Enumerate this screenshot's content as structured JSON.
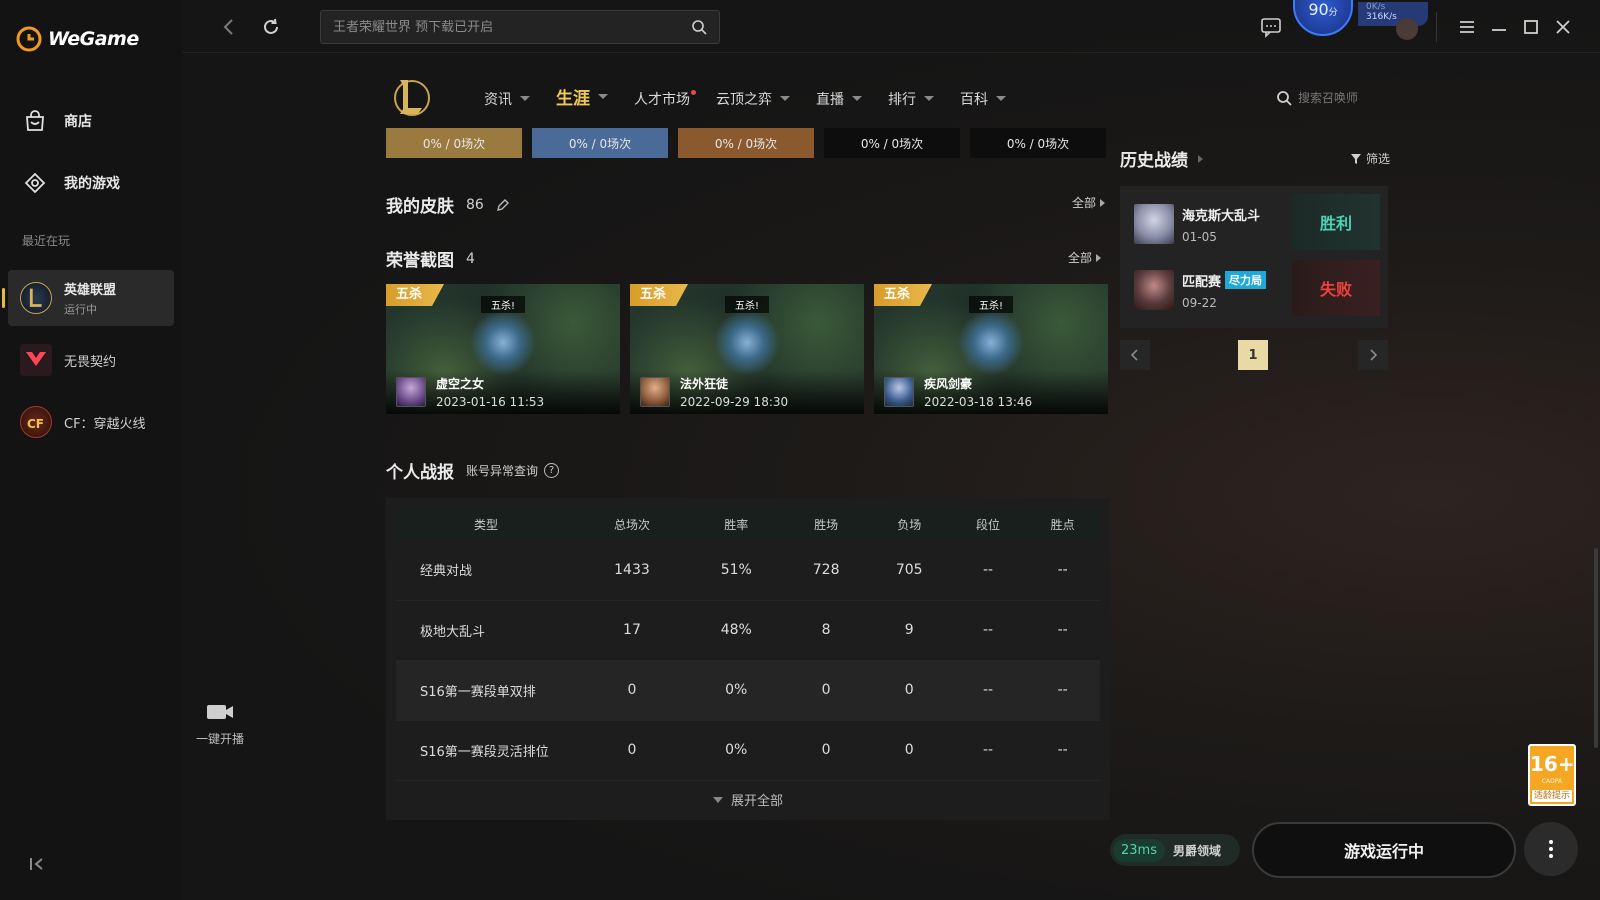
{
  "app": {
    "name": "WeGame"
  },
  "sidebar": {
    "nav": [
      {
        "label": "商店",
        "icon": "store-bag-icon"
      },
      {
        "label": "我的游戏",
        "icon": "game-controller-icon"
      }
    ],
    "recent_label": "最近在玩",
    "games": [
      {
        "title": "英雄联盟",
        "status": "运行中",
        "icon": "lol-icon",
        "active": true
      },
      {
        "title": "无畏契约",
        "status": "",
        "icon": "valorant-icon",
        "active": false
      },
      {
        "title": "CF：穿越火线",
        "status": "",
        "icon": "crossfire-icon",
        "active": false
      }
    ]
  },
  "topbar": {
    "search_placeholder": "王者荣耀世界 预下载已开启",
    "score_value": "90",
    "score_unit": "分",
    "net_speed_up": "0K/s",
    "net_speed_down": "316K/s"
  },
  "game_nav": {
    "items": [
      {
        "label": "资讯",
        "caret": true
      },
      {
        "label": "生涯",
        "caret": true,
        "active": true
      },
      {
        "label": "人才市场",
        "caret": false,
        "dot": true
      },
      {
        "label": "云顶之弈",
        "caret": true
      },
      {
        "label": "直播",
        "caret": true
      },
      {
        "label": "排行",
        "caret": true
      },
      {
        "label": "百科",
        "caret": true
      }
    ],
    "summoner_search_placeholder": "搜索召唤师"
  },
  "rank_bars": [
    {
      "text": "0% / 0场次",
      "color": "#9a7a3e"
    },
    {
      "text": "0% / 0场次",
      "color": "#4a6a98"
    },
    {
      "text": "0% / 0场次",
      "color": "#8a5a2e"
    },
    {
      "text": "0% / 0场次",
      "color": "#0d0d0d"
    },
    {
      "text": "0% / 0场次",
      "color": "#0d0d0d"
    }
  ],
  "skins": {
    "title": "我的皮肤",
    "count": "86",
    "see_all": "全部"
  },
  "screenshots": {
    "title": "荣誉截图",
    "count": "4",
    "see_all": "全部",
    "items": [
      {
        "tag": "五杀",
        "banner": "五杀!",
        "champion": "虚空之女",
        "date": "2023-01-16 11:53",
        "avatar_color": "#6a4a8a"
      },
      {
        "tag": "五杀",
        "banner": "五杀!",
        "champion": "法外狂徒",
        "date": "2022-09-29 18:30",
        "avatar_color": "#8a5a3a"
      },
      {
        "tag": "五杀",
        "banner": "五杀!",
        "champion": "疾风剑豪",
        "date": "2022-03-18 13:46",
        "avatar_color": "#3a5a8a"
      }
    ]
  },
  "stats": {
    "title": "个人战报",
    "account_link": "账号异常查询",
    "headers": [
      "类型",
      "总场次",
      "胜率",
      "胜场",
      "负场",
      "段位",
      "胜点"
    ],
    "rows": [
      [
        "经典对战",
        "1433",
        "51%",
        "728",
        "705",
        "--",
        "--"
      ],
      [
        "极地大乱斗",
        "17",
        "48%",
        "8",
        "9",
        "--",
        "--"
      ],
      [
        "S16第一赛段单双排",
        "0",
        "0%",
        "0",
        "0",
        "--",
        "--"
      ],
      [
        "S16第一赛段灵活排位",
        "0",
        "0%",
        "0",
        "0",
        "--",
        "--"
      ]
    ],
    "expand_label": "展开全部"
  },
  "history": {
    "title": "历史战绩",
    "filter_label": "筛选",
    "matches": [
      {
        "mode": "海克斯大乱斗",
        "badge": "",
        "date": "01-05",
        "result": "胜利",
        "outcome": "win",
        "avatar_color": "#8a8fa8"
      },
      {
        "mode": "匹配赛",
        "badge": "尽力局",
        "date": "09-22",
        "result": "失败",
        "outcome": "lose",
        "avatar_color": "#5a3a3a"
      }
    ],
    "page": "1"
  },
  "live": {
    "label": "一键开播"
  },
  "bottom": {
    "ping": "23ms",
    "server": "男爵领域",
    "run_button": "游戏运行中"
  },
  "age_rating": {
    "number": "16+",
    "sub": "CADPA",
    "tip": "适龄提示"
  }
}
